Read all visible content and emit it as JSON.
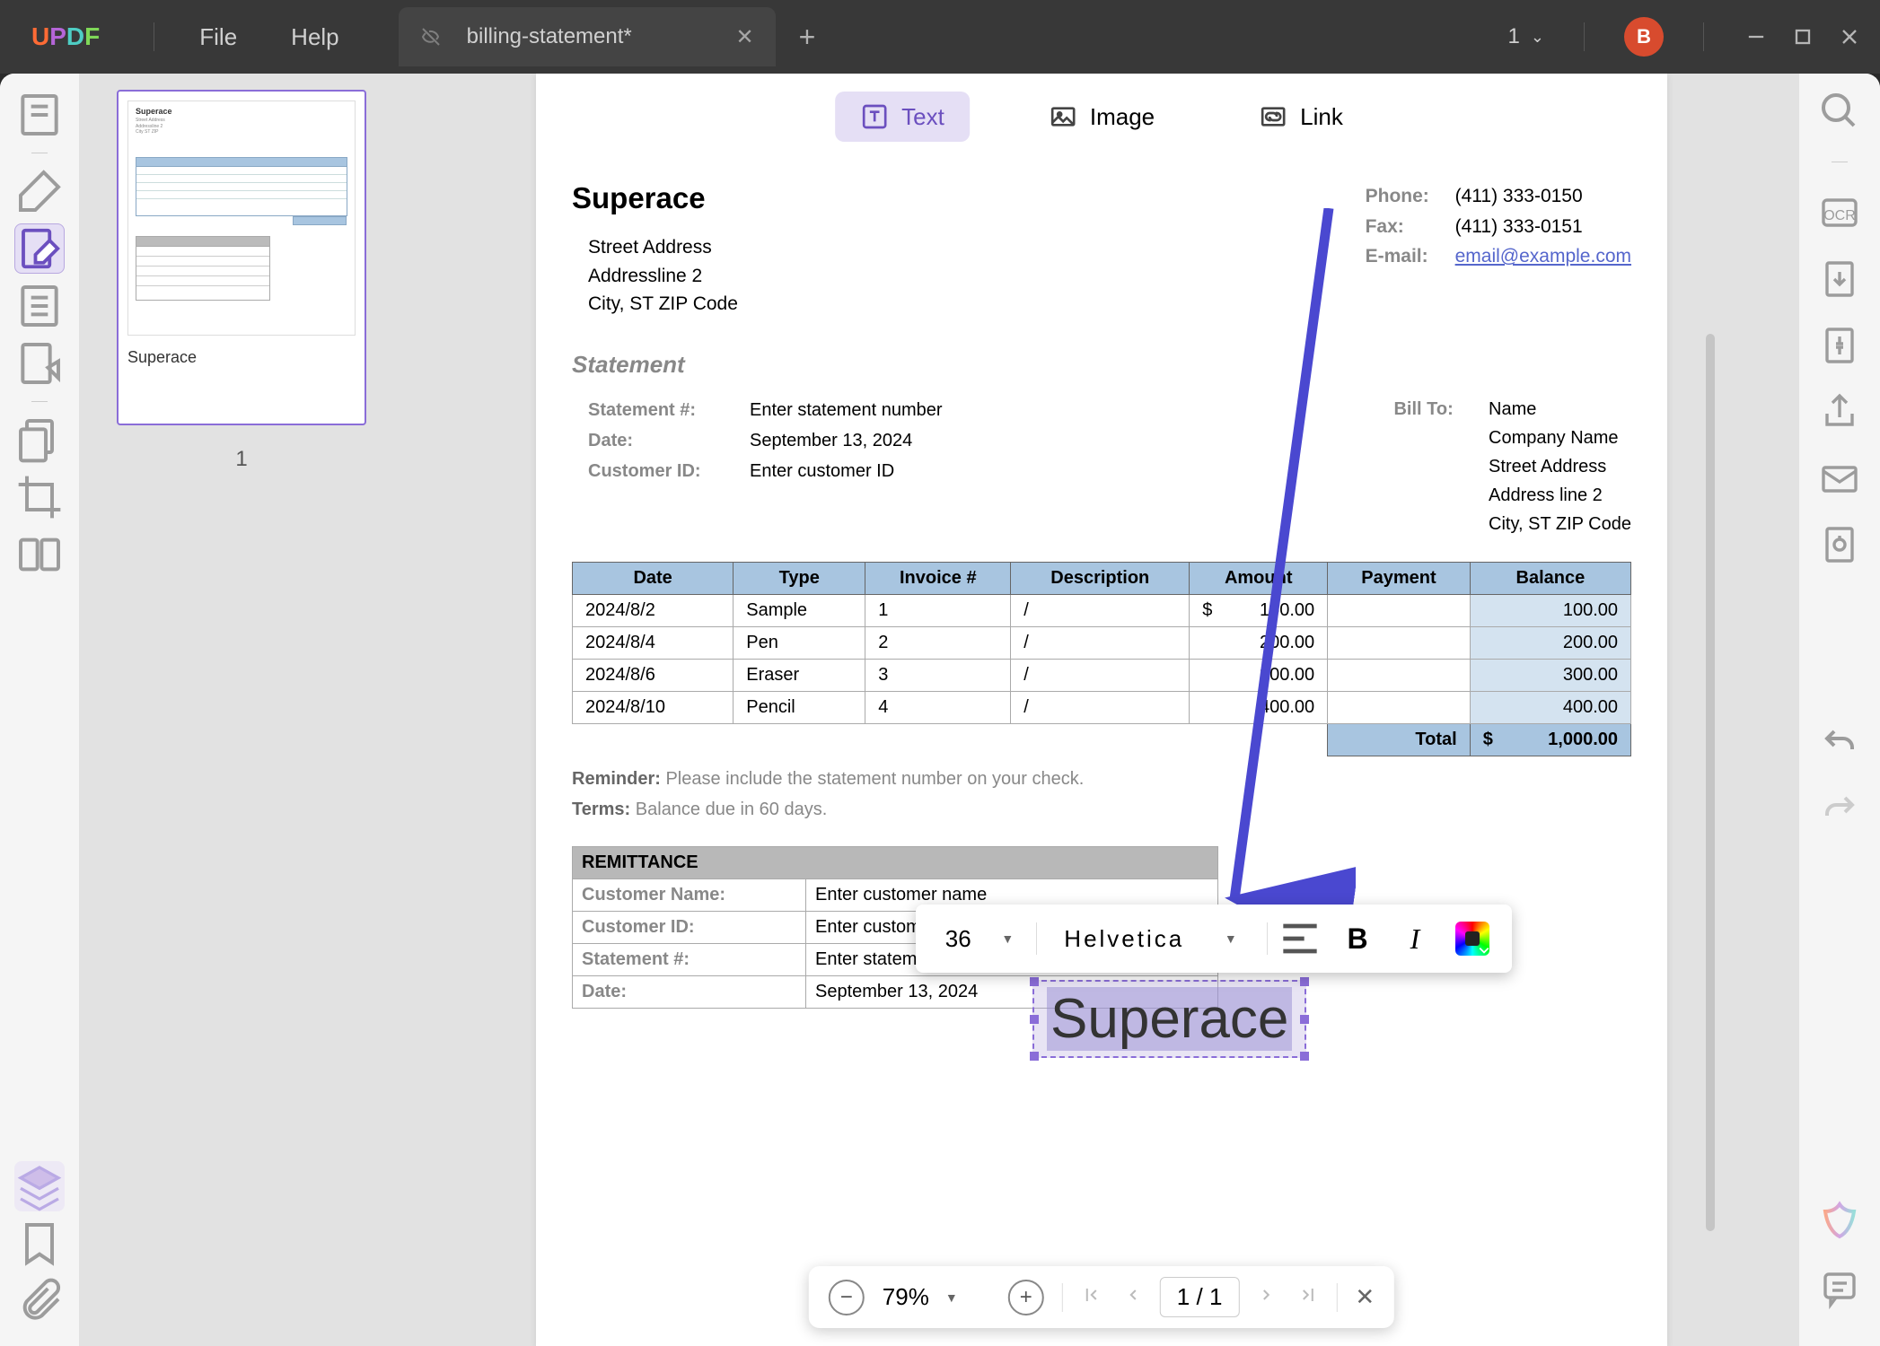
{
  "app": {
    "name": "UPDF"
  },
  "menu": {
    "file": "File",
    "help": "Help"
  },
  "tab": {
    "title": "billing-statement*"
  },
  "titlebar": {
    "page_ind": "1",
    "avatar_letter": "B"
  },
  "modes": {
    "text": "Text",
    "image": "Image",
    "link": "Link"
  },
  "sidebar": {
    "thumb_page_num": "1",
    "thumb_text": "Superace"
  },
  "doc": {
    "company": "Superace",
    "address": {
      "line1": "Street Address",
      "line2": "Addressline 2",
      "line3": "City, ST  ZIP Code"
    },
    "contact": {
      "phone_label": "Phone:",
      "phone": "(411) 333-0150",
      "fax_label": "Fax:",
      "fax": "(411) 333-0151",
      "email_label": "E-mail:",
      "email": "email@example.com"
    },
    "statement_title": "Statement",
    "stmt": {
      "num_label": "Statement #:",
      "num": "Enter statement number",
      "date_label": "Date:",
      "date": "September 13, 2024",
      "cust_label": "Customer ID:",
      "cust": "Enter customer ID"
    },
    "billto": {
      "label": "Bill To:",
      "name": "Name",
      "company": "Company Name",
      "street": "Street Address",
      "addr2": "Address line 2",
      "city": "City, ST  ZIP Code"
    },
    "table": {
      "headers": [
        "Date",
        "Type",
        "Invoice #",
        "Description",
        "Amount",
        "Payment",
        "Balance"
      ],
      "rows": [
        {
          "date": "2024/8/2",
          "type": "Sample",
          "invoice": "1",
          "desc": "/",
          "amount_prefix": "$",
          "amount": "100.00",
          "payment": "",
          "balance": "100.00"
        },
        {
          "date": "2024/8/4",
          "type": "Pen",
          "invoice": "2",
          "desc": "/",
          "amount_prefix": "",
          "amount": "200.00",
          "payment": "",
          "balance": "200.00"
        },
        {
          "date": "2024/8/6",
          "type": "Eraser",
          "invoice": "3",
          "desc": "/",
          "amount_prefix": "",
          "amount": "300.00",
          "payment": "",
          "balance": "300.00"
        },
        {
          "date": "2024/8/10",
          "type": "Pencil",
          "invoice": "4",
          "desc": "/",
          "amount_prefix": "",
          "amount": "400.00",
          "payment": "",
          "balance": "400.00"
        }
      ],
      "total_label": "Total",
      "total_prefix": "$",
      "total": "1,000.00"
    },
    "notes": {
      "reminder_label": "Reminder:",
      "reminder": "Please include the statement number on your check.",
      "terms_label": "Terms:",
      "terms": "Balance due in 60 days."
    },
    "remit": {
      "header": "REMITTANCE",
      "rows": [
        {
          "label": "Customer Name:",
          "value": "Enter customer name"
        },
        {
          "label": "Customer ID:",
          "value": "Enter customer ID"
        },
        {
          "label": "Statement #:",
          "value": "Enter statement number"
        },
        {
          "label": "Date:",
          "value": "September 13, 2024"
        }
      ]
    },
    "edit_text": "Superace"
  },
  "text_toolbar": {
    "size": "36",
    "font": "Helvetica",
    "bold": "B",
    "italic": "I"
  },
  "page_controls": {
    "zoom": "79%",
    "current": "1",
    "sep": "/",
    "total": "1"
  }
}
